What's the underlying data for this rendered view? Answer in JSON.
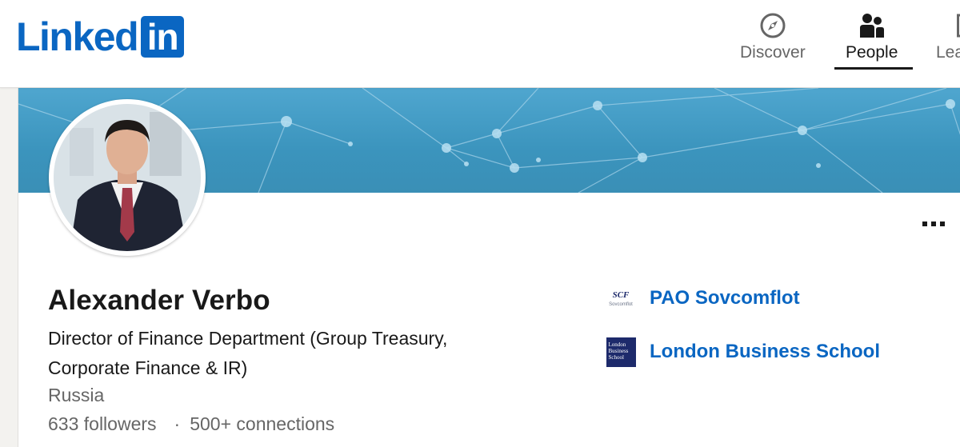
{
  "nav": {
    "logo_text": "Linked",
    "logo_box_text": "in",
    "items": [
      {
        "label": "Discover",
        "icon": "compass-icon"
      },
      {
        "label": "People",
        "icon": "people-icon",
        "active": true
      },
      {
        "label": "Lea",
        "icon": "learning-icon"
      }
    ]
  },
  "profile": {
    "name": "Alexander Verbo",
    "headline": "Director of Finance Department (Group Treasury, Corporate Finance & IR)",
    "location": "Russia",
    "followers": "633 followers",
    "separator": "·",
    "connections": "500+ connections",
    "more_label": "More actions"
  },
  "orgs": [
    {
      "name": "PAO Sovcomflot",
      "logo_text": "SCF",
      "logo_subtext": "Sovcomflot",
      "icon": "scf-logo"
    },
    {
      "name": "London Business School",
      "logo_text": "London Business School",
      "icon": "lbs-logo"
    }
  ],
  "colors": {
    "brand": "#0a66c2",
    "banner": "#3b94bd",
    "text": "#191919",
    "muted": "#666666"
  }
}
